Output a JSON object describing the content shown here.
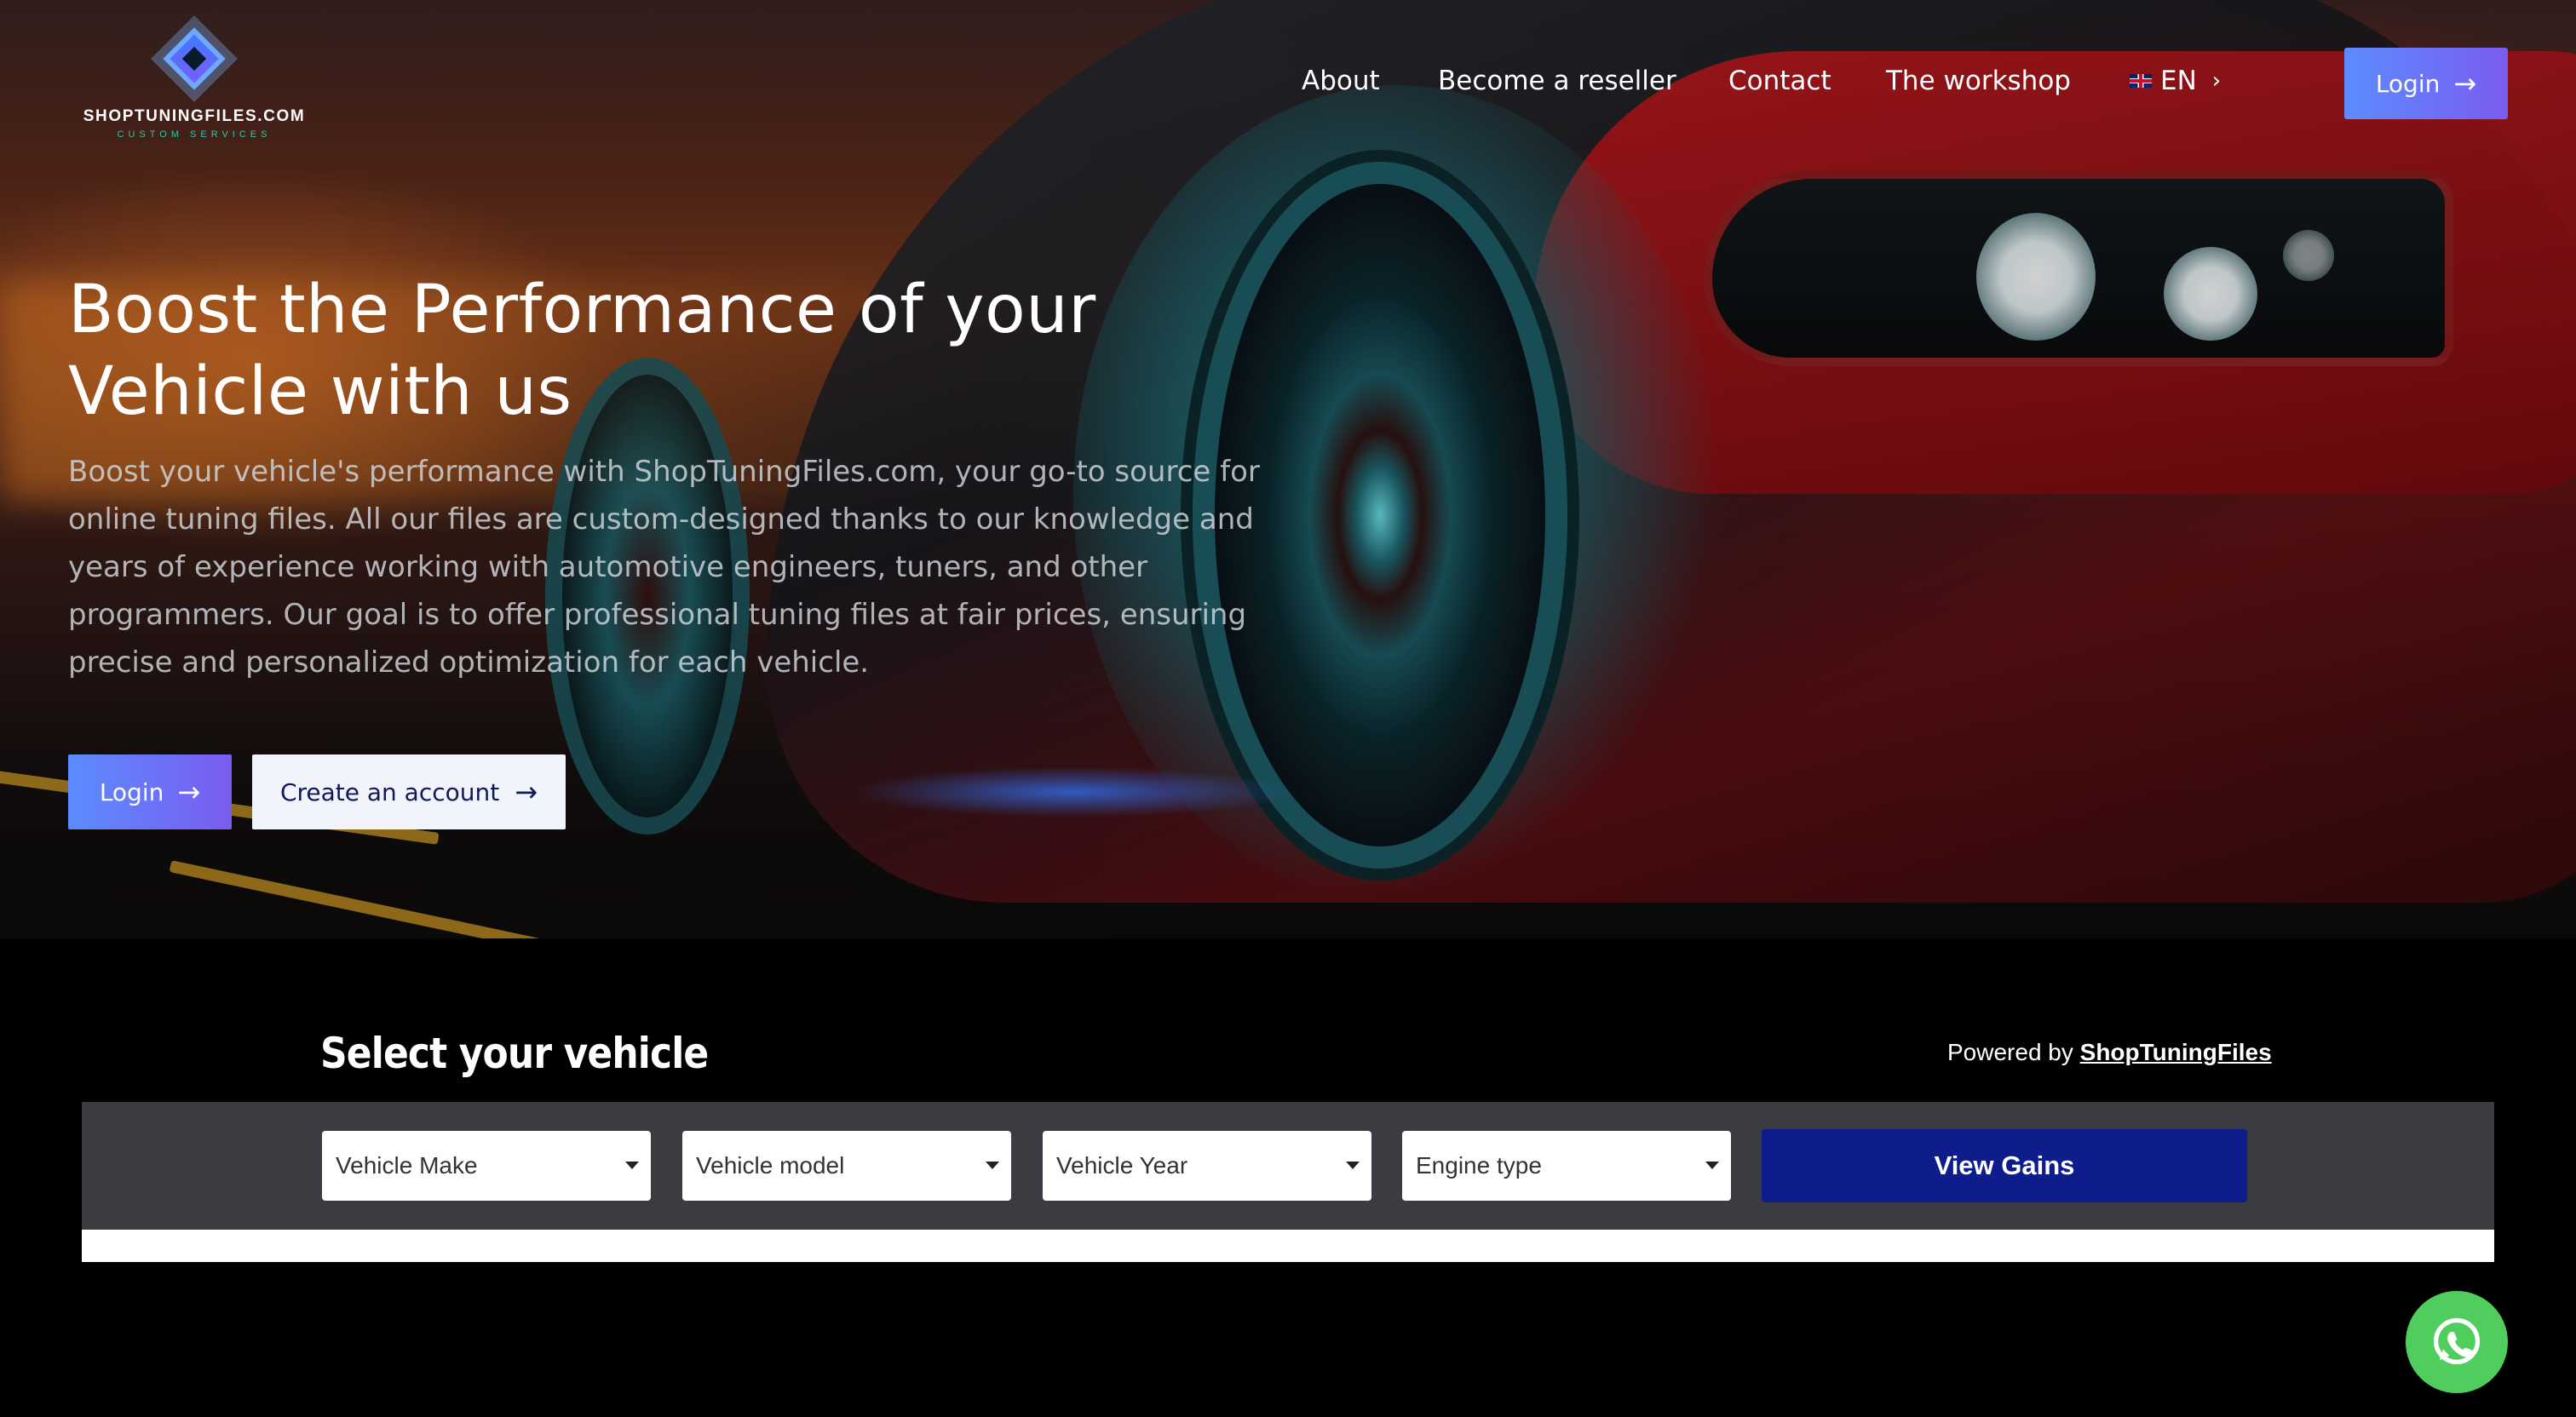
{
  "brand": {
    "name": "SHOPTUNINGFILES.COM",
    "tagline": "CUSTOM SERVICES"
  },
  "nav": {
    "items": [
      {
        "label": "About"
      },
      {
        "label": "Become a reseller"
      },
      {
        "label": "Contact"
      },
      {
        "label": "The workshop"
      }
    ],
    "language": "EN",
    "login_label": "Login"
  },
  "hero": {
    "title": "Boost the Performance of your Vehicle with us",
    "description": "Boost your vehicle's performance with ShopTuningFiles.com, your go-to source for online tuning files. All our files are custom-designed thanks to our knowledge and years of experience working with automotive engineers, tuners, and other programmers. Our goal is to offer professional tuning files at fair prices, ensuring precise and personalized optimization for each vehicle.",
    "login_label": "Login",
    "create_account_label": "Create an account"
  },
  "vehicle_selector": {
    "title": "Select your vehicle",
    "powered_by_prefix": "Powered by",
    "powered_by_link": "ShopTuningFiles",
    "selects": [
      {
        "placeholder": "Vehicle Make"
      },
      {
        "placeholder": "Vehicle model"
      },
      {
        "placeholder": "Vehicle Year"
      },
      {
        "placeholder": "Engine type"
      }
    ],
    "submit_label": "View Gains"
  },
  "icons": {
    "arrow": "arrow-right-icon",
    "chevron": "chevron-right-icon",
    "flag": "uk-flag-icon",
    "whatsapp": "whatsapp-icon",
    "select_caret": "caret-down-icon"
  },
  "colors": {
    "accent_gradient_start": "#5c8cff",
    "accent_gradient_end": "#7a5cf0",
    "view_gains_bg": "#0f1c8c",
    "selector_bar_bg": "#3a3c41",
    "whatsapp_green": "#4fce5d"
  }
}
